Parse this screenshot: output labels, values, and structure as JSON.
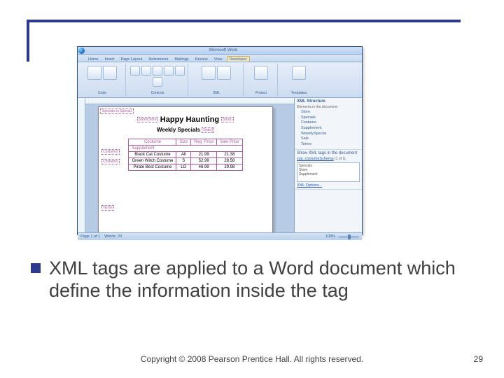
{
  "accent_color": "#2d3a8c",
  "word": {
    "title": "Microsoft Word",
    "tabs": [
      "Home",
      "Insert",
      "Page Layout",
      "References",
      "Mailings",
      "Review",
      "View",
      "Developer"
    ],
    "active_tab_index": 7,
    "ribbon_groups": [
      {
        "label": "Code"
      },
      {
        "label": "Controls"
      },
      {
        "label": "XML"
      },
      {
        "label": "Protect"
      },
      {
        "label": "Templates"
      }
    ],
    "doc": {
      "page_tag": "Specials is Special",
      "title_left_tag": "Store(Store",
      "title": "Happy Haunting",
      "title_right_tag": "Store)",
      "subtitle": "Weekly Specials",
      "subtitle_right_tag": "Date()",
      "left_tag_1": "Costume(",
      "left_tag_2": "Costume(",
      "bottom_tag": "Terms",
      "table": {
        "headers": [
          "Costume",
          "Size",
          "Reg. Price",
          "Sale Price"
        ],
        "sub": "Supplement",
        "rows": [
          [
            "Black Cat Costume",
            "All",
            "21.99",
            "21.38"
          ],
          [
            "Green Witch Costume",
            "S",
            "52.99",
            "28.58"
          ],
          [
            "Pirate Best Costume",
            "LG",
            "46.99",
            "29.98"
          ]
        ]
      }
    },
    "pane": {
      "title1": "XML Structure",
      "subtitle1": "Elements in the document:",
      "items": [
        "Store",
        "Specials",
        "Costume",
        "Supplement",
        "WeeklySpecial",
        "Sale",
        "Terms"
      ],
      "title2": "Show XML tags in the document",
      "link": "xsp_costumeSchema",
      "count": "[1 of 1]",
      "box_items": [
        "Specials",
        "Store",
        "Supplement",
        "XML Options..."
      ]
    },
    "status": {
      "left": "Page 1 of 1",
      "words": "Words: 29",
      "zoom": "100%"
    }
  },
  "bullet_text": "XML tags are applied to a Word document which define the information inside the tag",
  "copyright": "Copyright © 2008 Pearson Prentice Hall. All rights reserved.",
  "page_number": "29"
}
